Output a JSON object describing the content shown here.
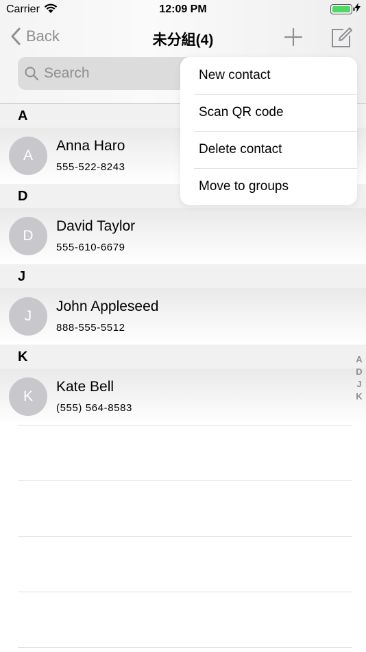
{
  "status_bar": {
    "carrier": "Carrier",
    "time": "12:09 PM",
    "battery_color": "#4cd964"
  },
  "nav": {
    "back_label": "Back",
    "title": "未分組(4)"
  },
  "search": {
    "placeholder": "Search"
  },
  "sections": [
    {
      "letter": "A",
      "contacts": [
        {
          "initial": "A",
          "name": "Anna Haro",
          "phone": "555-522-8243"
        }
      ]
    },
    {
      "letter": "D",
      "contacts": [
        {
          "initial": "D",
          "name": "David Taylor",
          "phone": "555-610-6679"
        }
      ]
    },
    {
      "letter": "J",
      "contacts": [
        {
          "initial": "J",
          "name": "John Appleseed",
          "phone": "888-555-5512"
        }
      ]
    },
    {
      "letter": "K",
      "contacts": [
        {
          "initial": "K",
          "name": "Kate Bell",
          "phone": "(555) 564-8583"
        }
      ]
    }
  ],
  "index": [
    "A",
    "D",
    "J",
    "K"
  ],
  "menu": {
    "items": [
      "New contact",
      "Scan QR code",
      "Delete contact",
      "Move to groups"
    ]
  }
}
